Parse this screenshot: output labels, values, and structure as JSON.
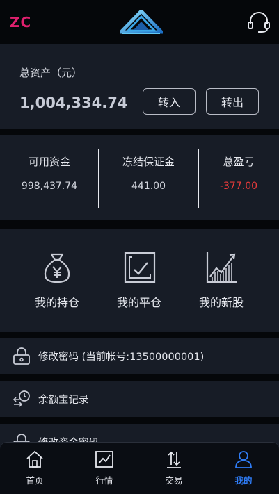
{
  "header": {
    "brand": "ZC",
    "logo_icon": "triangle-logo-icon",
    "support_icon": "headset-icon",
    "accent": "#e0206e"
  },
  "assets": {
    "label": "总资产（元）",
    "value": "1,004,334.74",
    "deposit_label": "转入",
    "withdraw_label": "转出"
  },
  "stats": [
    {
      "label": "可用资金",
      "value": "998,437.74"
    },
    {
      "label": "冻结保证金",
      "value": "441.00"
    },
    {
      "label": "总盈亏",
      "value": "-377.00",
      "color": "#ea3b3b"
    }
  ],
  "shortcuts": [
    {
      "label": "我的持仓",
      "icon": "money-bag-icon"
    },
    {
      "label": "我的平仓",
      "icon": "checkbox-icon"
    },
    {
      "label": "我的新股",
      "icon": "rising-chart-icon"
    }
  ],
  "menu": [
    {
      "label": "修改密码 (当前帐号:13500000001)",
      "icon": "lock-icon"
    },
    {
      "label": "余额宝记录",
      "icon": "clock-transfer-icon"
    },
    {
      "label": "修改资金密码",
      "icon": "lock-icon"
    }
  ],
  "tabs": [
    {
      "label": "首页",
      "icon": "home-icon",
      "active": false
    },
    {
      "label": "行情",
      "icon": "chart-icon",
      "active": false
    },
    {
      "label": "交易",
      "icon": "arrows-updown-icon",
      "active": false
    },
    {
      "label": "我的",
      "icon": "user-icon",
      "active": true
    }
  ],
  "colors": {
    "background": "#05070a",
    "card": "#171c26",
    "active_tab": "#2f7cf6",
    "negative": "#ea3b3b"
  }
}
